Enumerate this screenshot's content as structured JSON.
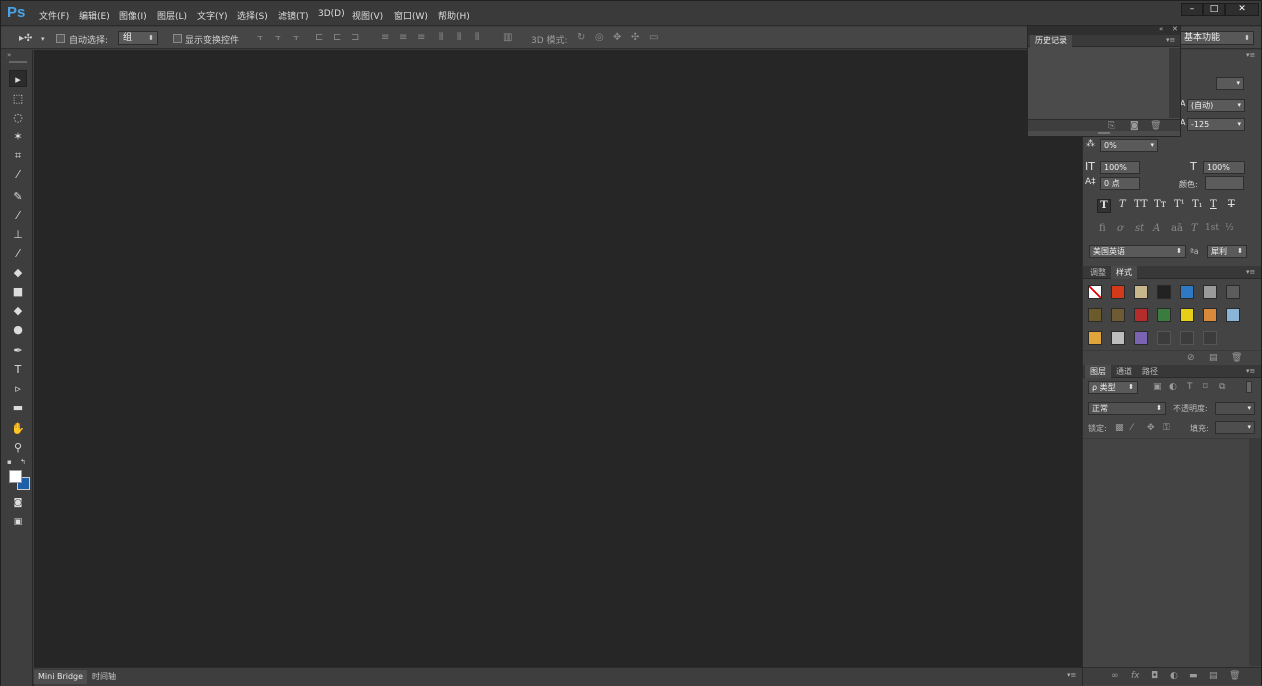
{
  "app": {
    "logo": "Ps"
  },
  "menu": [
    "文件(F)",
    "编辑(E)",
    "图像(I)",
    "图层(L)",
    "文字(Y)",
    "选择(S)",
    "滤镜(T)",
    "3D(D)",
    "视图(V)",
    "窗口(W)",
    "帮助(H)"
  ],
  "window_controls": {
    "minimize": "–",
    "maximize": "□",
    "close": "✕"
  },
  "options": {
    "move_icon": "▸✣",
    "auto_select_label": "自动选择:",
    "auto_select_value": "组",
    "show_transform_label": "显示变换控件",
    "mode_3d_label": "3D 模式:",
    "workspace": "基本功能"
  },
  "tools": [
    "move-tool-icon",
    "marquee-tool-icon",
    "lasso-tool-icon",
    "magic-wand-icon",
    "crop-tool-icon",
    "eyedropper-icon",
    "healing-brush-icon",
    "brush-icon",
    "stamp-icon",
    "history-brush-icon",
    "eraser-icon",
    "gradient-icon",
    "blur-icon",
    "dodge-icon",
    "pen-icon",
    "type-icon",
    "path-select-icon",
    "shape-icon",
    "hand-icon",
    "zoom-icon"
  ],
  "bottom_tabs": [
    "Mini Bridge",
    "时间轴"
  ],
  "history": {
    "tab": "历史记录"
  },
  "character": {
    "auto_leading": "(自动)",
    "tracking": "-125",
    "baseline_pct": "0%",
    "vertical_scale": "100%",
    "horizontal_scale": "100%",
    "baseline_shift": "0 点",
    "color_label": "颜色:",
    "style_buttons": [
      "T",
      "T",
      "TT",
      "Tт",
      "T¹",
      "T₁",
      "T",
      "T"
    ],
    "opentype_buttons": [
      "fi",
      "ơ",
      "st",
      "A",
      "aā",
      "T",
      "1st",
      "½"
    ],
    "language": "美国英语",
    "aa_label": "ªa",
    "aa_value": "犀利"
  },
  "styles_panel": {
    "tabs": [
      "调整",
      "样式"
    ],
    "swatches": [
      {
        "color": "#ffffff",
        "style": "none"
      },
      {
        "color": "#d43a1a"
      },
      {
        "color": "#c9b78c"
      },
      {
        "color": "#222222"
      },
      {
        "color": "#2f79c4"
      },
      {
        "color": "#9a9a9a"
      },
      {
        "color": "#5c5c5c"
      },
      {
        "color": "#6b5a2a"
      },
      {
        "color": "#6e5a34"
      },
      {
        "color": "#b52c2c"
      },
      {
        "color": "#3a7b3e"
      },
      {
        "color": "#e6cf18"
      },
      {
        "color": "#d88a3a"
      },
      {
        "color": "#8ab4d8"
      },
      {
        "color": "#e0a43a"
      },
      {
        "color": "#bdbdbd"
      },
      {
        "color": "#7a63b0"
      },
      {
        "color": "empty"
      },
      {
        "color": "empty"
      },
      {
        "color": "empty"
      }
    ]
  },
  "layers_panel": {
    "tabs": [
      "图层",
      "通道",
      "路径"
    ],
    "filter_label": "ρ 类型",
    "blend_mode": "正常",
    "opacity_label": "不透明度:",
    "lock_label": "锁定:",
    "fill_label": "填充:"
  }
}
